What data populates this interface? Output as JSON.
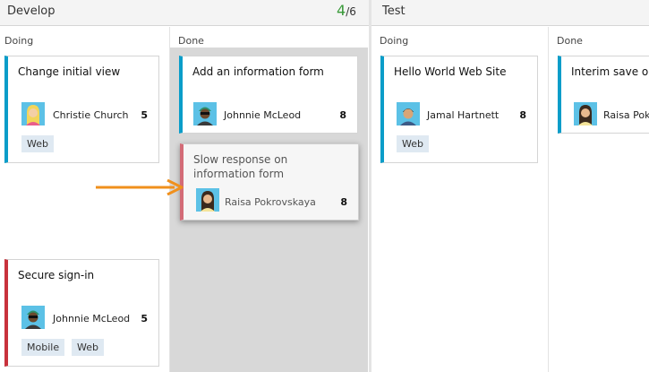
{
  "lanes": [
    {
      "title": "Develop",
      "count": "4",
      "limit": "/6",
      "columns": [
        {
          "header": "Doing",
          "cards": [
            {
              "title": "Change initial view",
              "assignee": "Christie Church",
              "effort": "5",
              "tags": [
                "Web"
              ]
            },
            {
              "title": "Secure sign-in",
              "assignee": "Johnnie McLeod",
              "effort": "5",
              "tags": [
                "Mobile",
                "Web"
              ]
            }
          ]
        },
        {
          "header": "Done",
          "cards": [
            {
              "title": "Add an information form",
              "assignee": "Johnnie McLeod",
              "effort": "8",
              "tags": []
            },
            {
              "title": "Slow response on information form",
              "assignee": "Raisa Pokrovskaya",
              "effort": "8",
              "tags": []
            }
          ]
        }
      ]
    },
    {
      "title": "Test",
      "columns": [
        {
          "header": "Doing",
          "cards": [
            {
              "title": "Hello World Web Site",
              "assignee": "Jamal Hartnett",
              "effort": "8",
              "tags": [
                "Web"
              ]
            }
          ]
        },
        {
          "header": "Done",
          "cards": [
            {
              "title": "Interim save on l",
              "assignee": "Raisa Pok",
              "effort": "",
              "tags": []
            }
          ]
        }
      ]
    }
  ],
  "colors": {
    "accent_blue": "#0a9dc9",
    "accent_red": "#c8323c",
    "count_green": "#3a9a3a",
    "drag_arrow": "#f0901c",
    "tag_bg": "#dfe9f2"
  }
}
